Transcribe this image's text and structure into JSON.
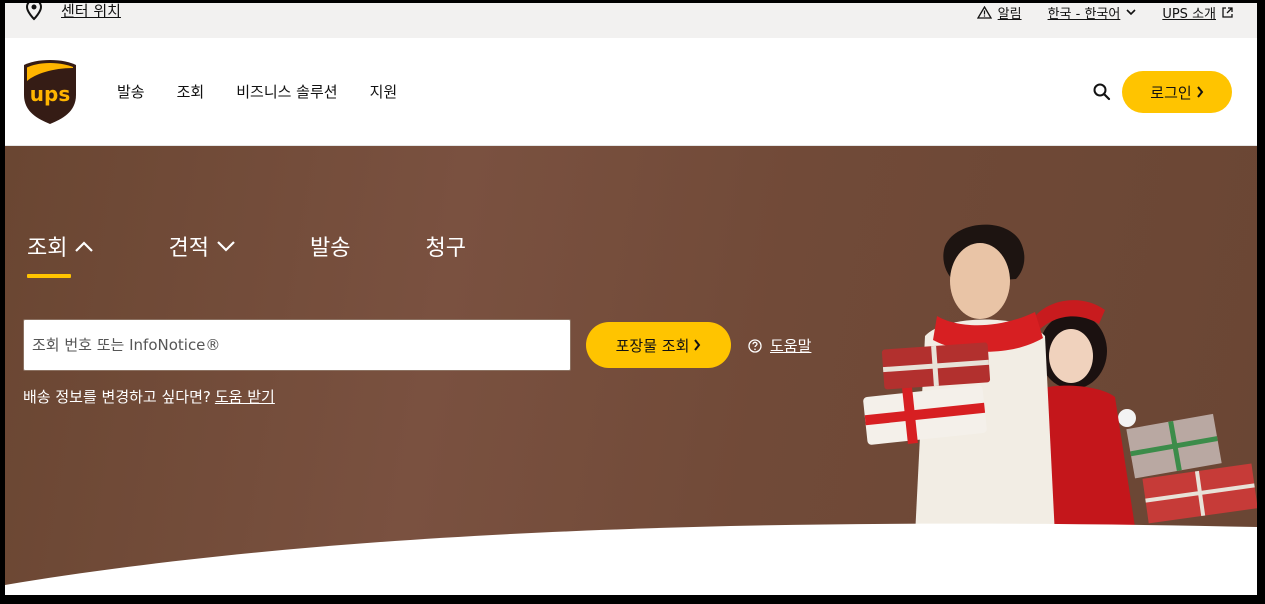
{
  "utility": {
    "location_label": "센터 위치",
    "alerts_label": "알림",
    "language_label": "한국 - 한국어",
    "about_label": "UPS 소개"
  },
  "header": {
    "logo_text": "ups",
    "nav": [
      "발송",
      "조회",
      "비즈니스 솔루션",
      "지원"
    ],
    "login_label": "로그인"
  },
  "hero": {
    "tabs": [
      "조회",
      "견적",
      "발송",
      "청구"
    ],
    "active_tab": "조회",
    "track_placeholder": "조회 번호 또는 InfoNotice®",
    "track_button": "포장물 조회",
    "help_label": "도움말",
    "change_prompt": "배송 정보를 변경하고 싶다면?",
    "change_link": "도움 받기"
  },
  "colors": {
    "brand_yellow": "#ffc400",
    "brand_brown": "#6f4a37",
    "utility_bg": "#f2f1f0"
  }
}
